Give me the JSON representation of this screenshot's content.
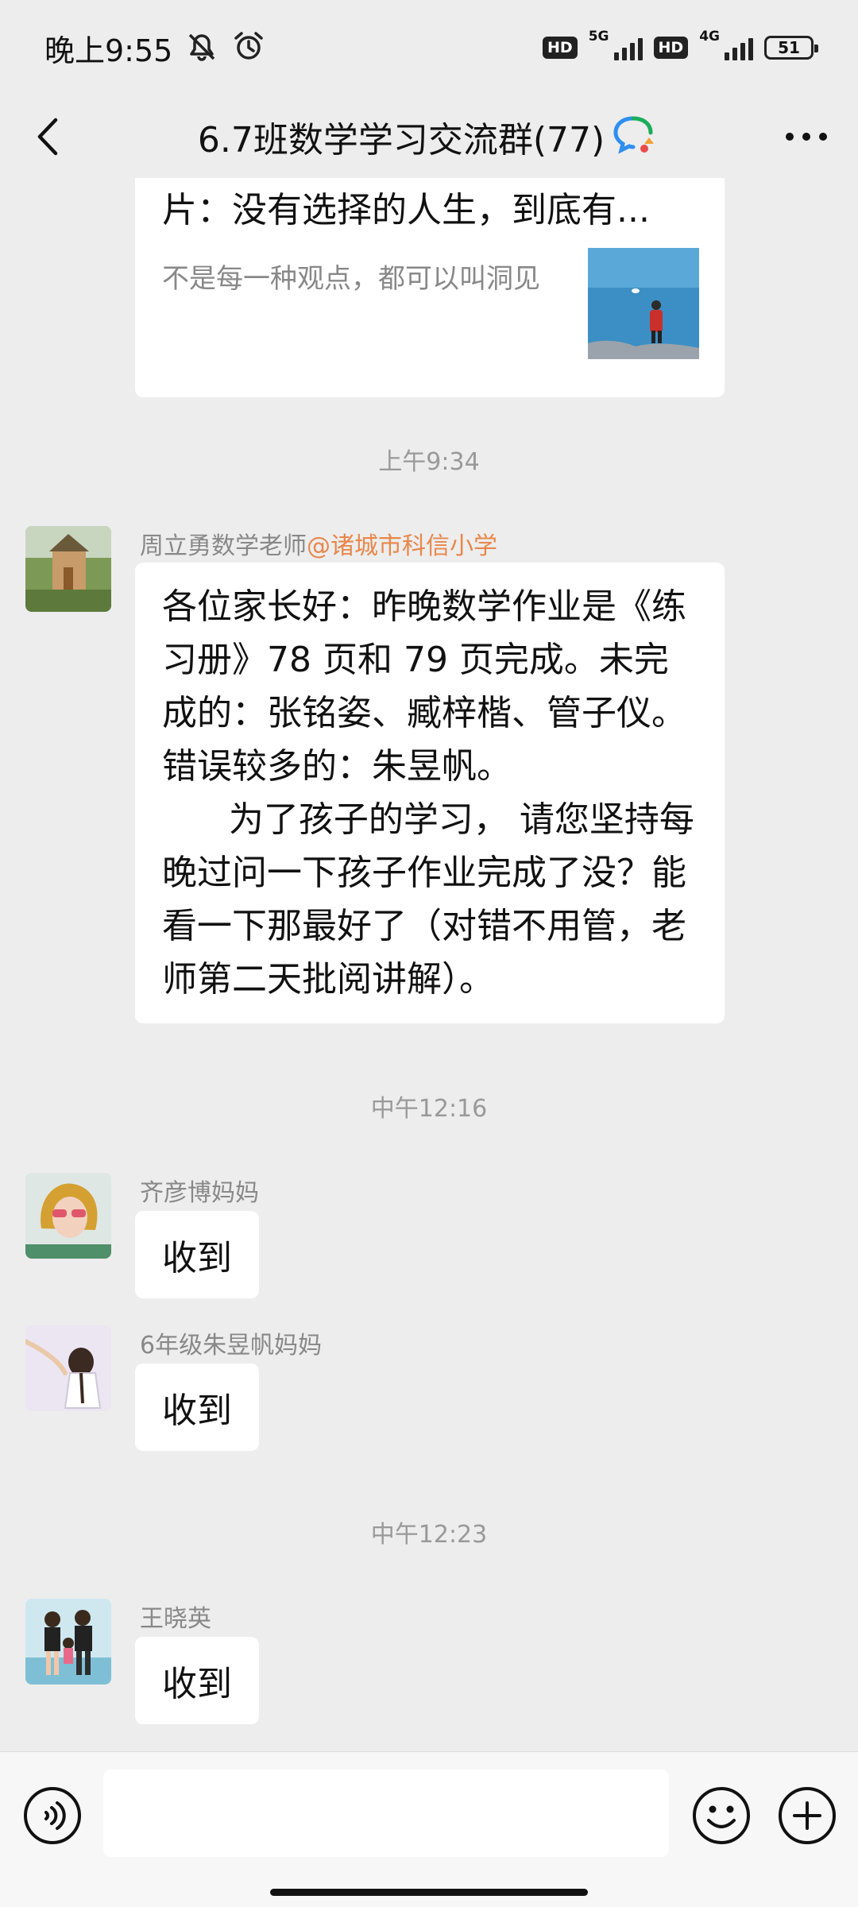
{
  "status_bar": {
    "time": "晚上9:55",
    "hd1": "HD",
    "net1": "5G",
    "hd2": "HD",
    "net2": "4G",
    "battery": "51",
    "icons": [
      "mute-icon",
      "alarm-icon"
    ]
  },
  "header": {
    "title": "6.7班数学学习交流群(77)",
    "icons": [
      "back-arrow-icon",
      "chat-bubble-icon",
      "more-icon"
    ]
  },
  "shared_article": {
    "title": "片：没有选择的人生，到底有...",
    "description": "不是每一种观点，都可以叫洞见"
  },
  "messages": [
    {
      "time_separator": "上午9:34",
      "sender": "周立勇数学老师",
      "sender_org": "@诸城市科信小学",
      "text": "各位家长好：昨晚数学作业是《练习册》78 页和 79 页完成。未完成的：张铭姿、臧梓楷、管子仪。错误较多的：朱昱帆。\n      为了孩子的学习， 请您坚持每晚过问一下孩子作业完成了没？能看一下那最好了（对错不用管，老师第二天批阅讲解）。"
    },
    {
      "time_separator": "中午12:16",
      "sender": "齐彦博妈妈",
      "text": "收到"
    },
    {
      "sender": "6年级朱昱帆妈妈",
      "text": "收到"
    },
    {
      "time_separator": "中午12:23",
      "sender": "王晓英",
      "text": "收到"
    }
  ],
  "input_bar": {
    "text": "",
    "icons": [
      "voice-icon",
      "emoji-icon",
      "plus-icon"
    ]
  },
  "colors": {
    "background": "#ededed",
    "bubble": "#ffffff",
    "muted_text": "#888888",
    "mention": "#e8874b"
  }
}
